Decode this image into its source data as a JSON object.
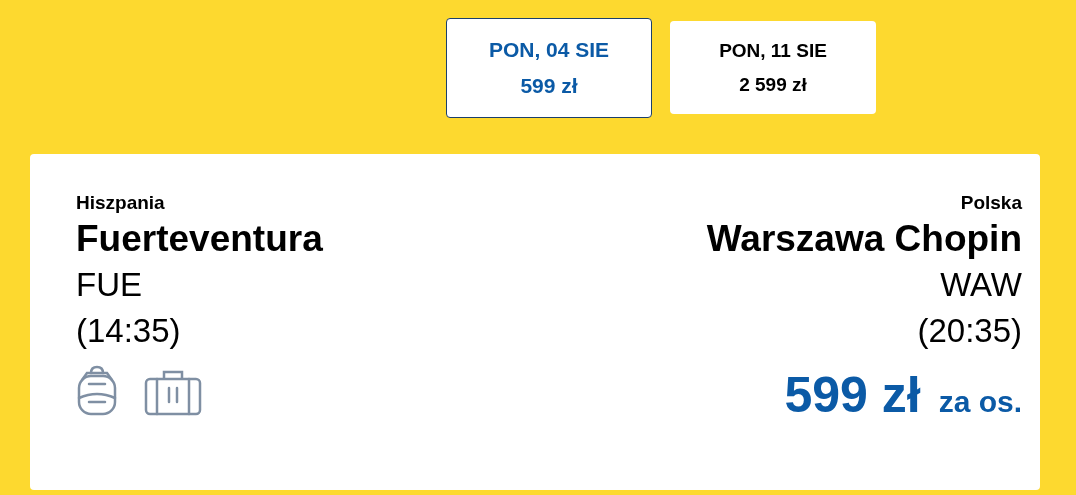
{
  "dates": [
    {
      "day": "PON, 04 SIE",
      "price": "599 zł",
      "selected": true
    },
    {
      "day": "PON, 11 SIE",
      "price": "2 599 zł",
      "selected": false
    }
  ],
  "flight": {
    "origin": {
      "country": "Hiszpania",
      "city": "Fuerteventura",
      "code": "FUE",
      "time": "(14:35)"
    },
    "destination": {
      "country": "Polska",
      "city": "Warszawa Chopin",
      "code": "WAW",
      "time": "(20:35)"
    },
    "price": "599 zł",
    "per_person": "za os."
  }
}
